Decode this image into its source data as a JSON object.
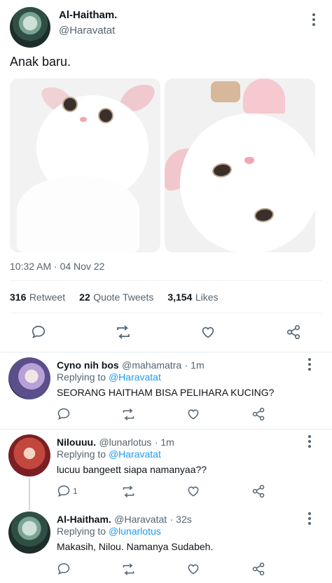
{
  "main_tweet": {
    "author_name": "Al-Haitham.",
    "author_handle": "@Haravatat",
    "text": "Anak baru.",
    "timestamp": "10:32 AM · 04 Nov 22",
    "stats": {
      "retweets_count": "316",
      "retweets_label": "Retweet",
      "quotes_count": "22",
      "quotes_label": "Quote Tweets",
      "likes_count": "3,154",
      "likes_label": "Likes"
    },
    "actions": [
      "reply-icon",
      "retweet-icon",
      "like-icon",
      "share-icon"
    ]
  },
  "replies": [
    {
      "name": "Cyno nih bos",
      "handle": "@mahamatra",
      "time": "· 1m",
      "replying_prefix": "Replying to",
      "replying_to": "@Haravatat",
      "text": "SEORANG HAITHAM BISA PELIHARA KUCING?",
      "reply_count": ""
    },
    {
      "name": "Nilouuu.",
      "handle": "@lunarlotus",
      "time": "· 1m",
      "replying_prefix": "Replying to",
      "replying_to": "@Haravatat",
      "text": "lucuu bangeett siapa namanyaa??",
      "reply_count": "1"
    },
    {
      "name": "Al-Haitham.",
      "handle": "@Haravatat",
      "time": "· 32s",
      "replying_prefix": "Replying to",
      "replying_to": "@lunarlotus",
      "text": "Makasih, Nilou. Namanya Sudabeh.",
      "reply_count": ""
    }
  ],
  "colors": {
    "text": "#0f1419",
    "secondary": "#536471",
    "link": "#1d9bf0",
    "divider": "#eff3f4"
  }
}
